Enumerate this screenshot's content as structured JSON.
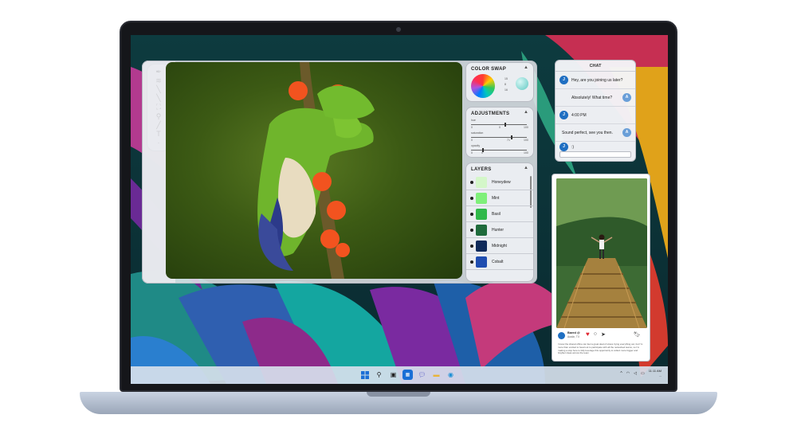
{
  "color_swap": {
    "title": "COLOR SWAP",
    "values": [
      "15",
      "8",
      "16"
    ]
  },
  "adjustments": {
    "title": "ADJUSTMENTS",
    "sliders": [
      {
        "label": "hue",
        "left": "0",
        "mid": "0",
        "right": "100",
        "level": 0.6
      },
      {
        "label": "saturation",
        "left": "0",
        "mid": "71",
        "right": "100",
        "level": 0.71
      },
      {
        "label": "opacity",
        "left": "0",
        "mid": "0",
        "right": "100",
        "level": 0.2
      }
    ]
  },
  "layers": {
    "title": "LAYERS",
    "items": [
      {
        "name": "Honeydew",
        "color": "#d4f7c9"
      },
      {
        "name": "Mint",
        "color": "#7ff07a"
      },
      {
        "name": "Basil",
        "color": "#2fb84a"
      },
      {
        "name": "Hunter",
        "color": "#1f6b3c"
      },
      {
        "name": "Midnight",
        "color": "#0f2a5a"
      },
      {
        "name": "Cobalt",
        "color": "#1f4db0"
      }
    ]
  },
  "chat": {
    "title": "CHAT",
    "messages": [
      {
        "from": "J",
        "side": "left",
        "text": "Hey, are you joining us later?"
      },
      {
        "from": "A",
        "side": "right",
        "text": "Absolutely! What time?"
      },
      {
        "from": "J",
        "side": "left",
        "text": "4:00 PM"
      },
      {
        "from": "A",
        "side": "right",
        "text": "Sound perfect, see you then."
      },
      {
        "from": "J",
        "side": "left",
        "text": ":)"
      }
    ]
  },
  "post": {
    "user": "Bared @",
    "location": "Austin, TX",
    "caption": "I know the shared office can feel a great deal of stress trying everything out, but I'm more than excited to head out to participate with all the networked teams, so I'm making a stop here to fully leverage this opportunity to collect more bigger and brighter ideas across the team",
    "like_color": "#e0262f"
  },
  "taskbar": {
    "icons": [
      "start-icon",
      "search-icon",
      "task-view-icon",
      "store-icon",
      "chat-icon",
      "explorer-icon",
      "edge-icon"
    ],
    "tray_lang": "ENG",
    "tray_region": "US",
    "time": "11:11 AM",
    "date": "..."
  }
}
